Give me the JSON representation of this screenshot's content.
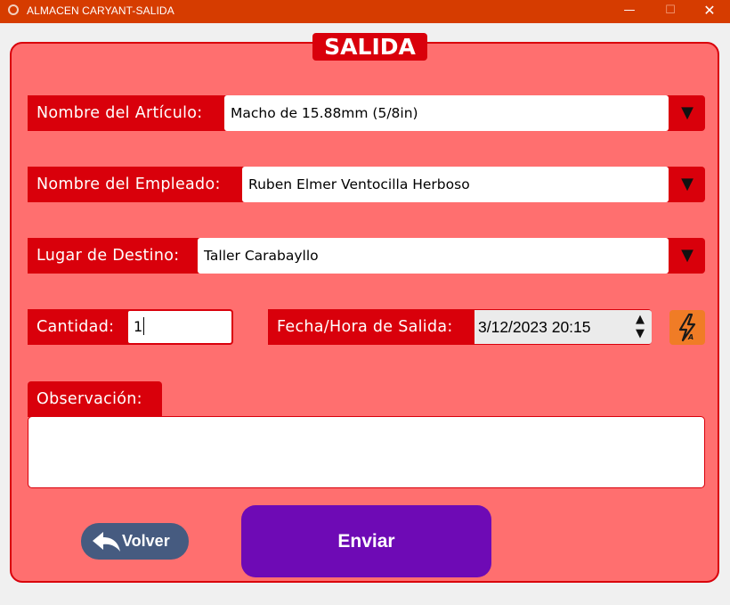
{
  "window": {
    "title": "ALMACEN CARYANT-SALIDA",
    "minimize_glyph": "—",
    "maximize_glyph": "☐",
    "close_glyph": "✕"
  },
  "header": {
    "title": "SALIDA"
  },
  "form": {
    "article": {
      "label": "Nombre del Artículo:",
      "value": "Macho de 15.88mm (5/8in)",
      "arrow": "▼"
    },
    "employee": {
      "label": "Nombre del Empleado:",
      "value": "Ruben Elmer Ventocilla Herboso",
      "arrow": "▼"
    },
    "destination": {
      "label": "Lugar de Destino:",
      "value": "Taller Carabayllo",
      "arrow": "▼"
    },
    "quantity": {
      "label": "Cantidad:",
      "value": "1"
    },
    "datetime": {
      "label": "Fecha/Hora de Salida:",
      "value": "3/12/2023 20:15",
      "up": "▲",
      "down": "▼"
    },
    "observation": {
      "label": "Observación:",
      "value": ""
    }
  },
  "buttons": {
    "back": "Volver",
    "send": "Enviar"
  },
  "icons": {
    "app": "app-icon",
    "auto_datetime": "lightning-icon",
    "back": "reply-arrow-icon"
  },
  "colors": {
    "titlebar": "#d63c00",
    "panel": "#ff6f6f",
    "accent_red": "#d9000b",
    "auto_button": "#f07c26",
    "back_button": "#465b80",
    "send_button": "#6e0ab5"
  }
}
